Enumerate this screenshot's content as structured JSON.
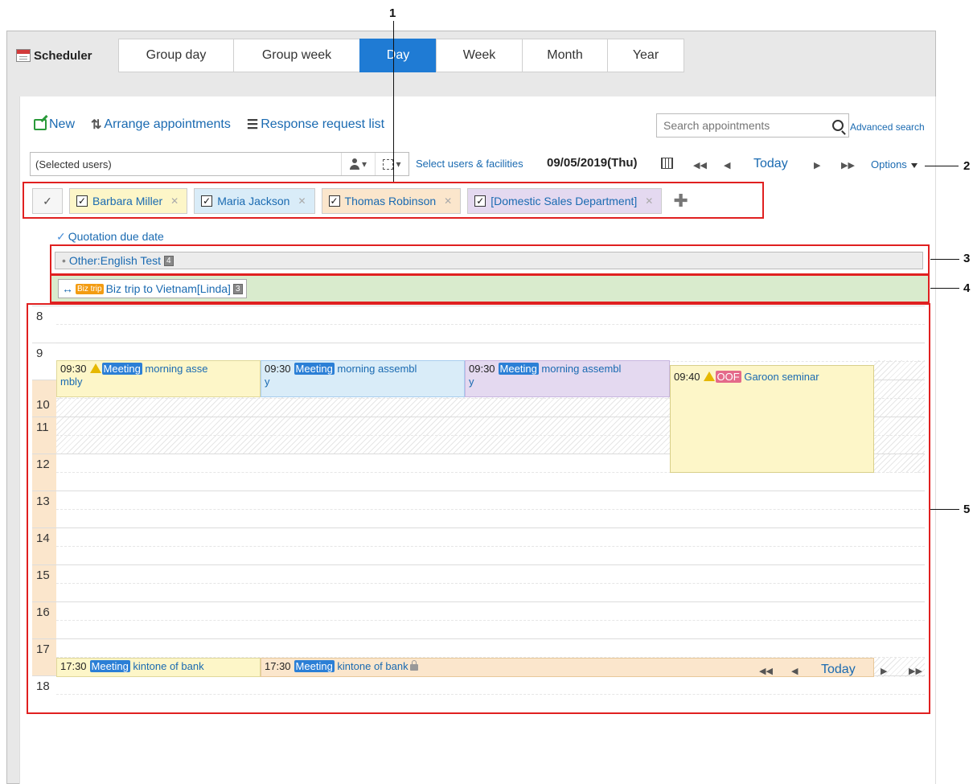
{
  "app": {
    "title": "Scheduler"
  },
  "tabs": [
    {
      "label": "Group day",
      "active": false
    },
    {
      "label": "Group week",
      "active": false
    },
    {
      "label": "Day",
      "active": true
    },
    {
      "label": "Week",
      "active": false
    },
    {
      "label": "Month",
      "active": false
    },
    {
      "label": "Year",
      "active": false
    }
  ],
  "toolbar": {
    "new_label": "New",
    "arrange_label": "Arrange appointments",
    "response_label": "Response request list"
  },
  "search": {
    "placeholder": "Search appointments",
    "advanced_label": "Advanced search"
  },
  "selector": {
    "value": "(Selected users)",
    "select_link": "Select users & facilities",
    "date": "09/05/2019(Thu)",
    "nav": {
      "first": "◀◀",
      "prev": "◀",
      "today": "Today",
      "next": "▶",
      "last": "▶▶"
    },
    "options_label": "Options"
  },
  "chips": [
    {
      "label": "Barbara Miller",
      "checked": true,
      "color": "#fdf6c8"
    },
    {
      "label": "Maria Jackson",
      "checked": true,
      "color": "#d9ecf8"
    },
    {
      "label": "Thomas Robinson",
      "checked": true,
      "color": "#fbe6cc"
    },
    {
      "label": "[Domestic Sales Department]",
      "checked": true,
      "color": "#e4d9f0"
    }
  ],
  "allday": {
    "quotation": "Quotation due date",
    "english": "Other:English Test",
    "english_count": "4",
    "biztrip_tag": "Biz trip",
    "biztrip": "Biz trip to Vietnam[Linda]",
    "biztrip_count": "3"
  },
  "hours": [
    "8",
    "9",
    "10",
    "11",
    "12",
    "13",
    "14",
    "15",
    "16",
    "17",
    "18"
  ],
  "events": {
    "e1": {
      "time": "09:30",
      "tag": "Meeting",
      "title": "morning asse",
      "title2": "mbly"
    },
    "e2": {
      "time": "09:30",
      "tag": "Meeting",
      "title": "morning assembl",
      "title2": "y"
    },
    "e3": {
      "time": "09:30",
      "tag": "Meeting",
      "title": "morning assembl",
      "title2": "y"
    },
    "e4": {
      "time": "09:40",
      "tag": "OOF",
      "title": "Garoon seminar"
    },
    "e5": {
      "time": "17:30",
      "tag": "Meeting",
      "title": "kintone of bank"
    },
    "e6": {
      "time": "17:30",
      "tag": "Meeting",
      "title": "kintone of bank"
    }
  },
  "callouts": [
    "1",
    "2",
    "3",
    "4",
    "5"
  ],
  "colors": {
    "accent": "#1f7bd4",
    "link": "#1a6ab1",
    "callout": "#e02020"
  }
}
